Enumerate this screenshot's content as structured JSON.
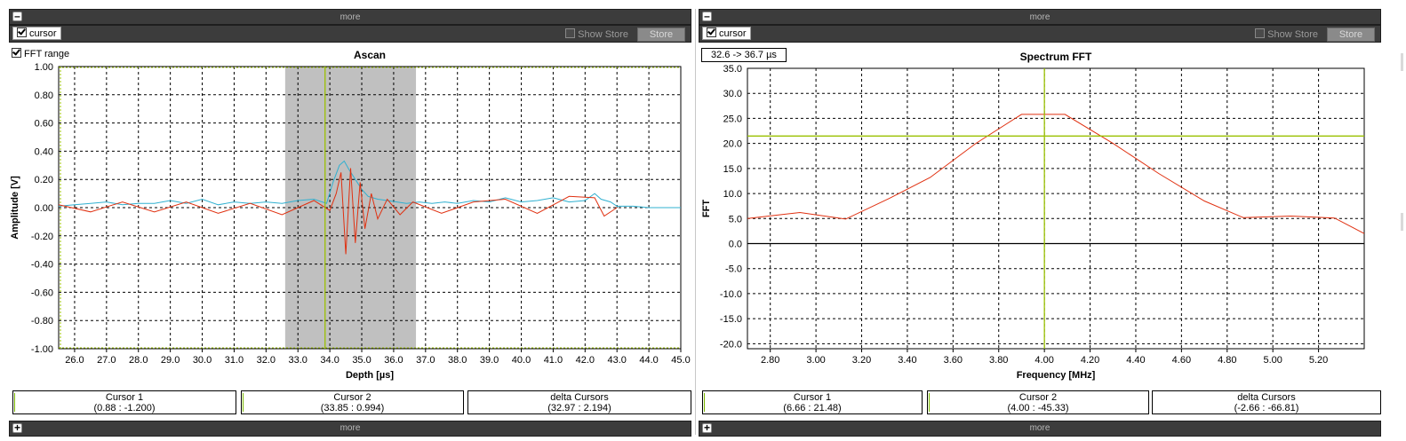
{
  "header": {
    "more_label": "more"
  },
  "toolbar": {
    "cursor_label": "cursor",
    "show_store_label": "Show Store",
    "store_button_label": "Store"
  },
  "ascan": {
    "fft_range_label": "FFT range",
    "cursor1": {
      "title": "Cursor 1",
      "value": "(0.88 : -1.200)"
    },
    "cursor2": {
      "title": "Cursor 2",
      "value": "(33.85 : 0.994)"
    },
    "delta": {
      "title": "delta Cursors",
      "value": "(32.97 : 2.194)"
    }
  },
  "fft": {
    "range_label": "32.6 -> 36.7 µs",
    "cursor1": {
      "title": "Cursor 1",
      "value": "(6.66 : 21.48)"
    },
    "cursor2": {
      "title": "Cursor 2",
      "value": "(4.00 : -45.33)"
    },
    "delta": {
      "title": "delta Cursors",
      "value": "(-2.66 : -66.81)"
    }
  },
  "colors": {
    "signal": "#e03010",
    "envelope": "#30b0d0",
    "cursor": "#9ac000",
    "window": "#c0c0c0",
    "panel_bar": "#3c3c3c"
  },
  "chart_data": [
    {
      "type": "line",
      "title": "Ascan",
      "xlabel": "Depth [µs]",
      "ylabel": "Amplitude [V]",
      "xlim": [
        25.5,
        45.0
      ],
      "ylim": [
        -1.0,
        1.0
      ],
      "x_ticks": [
        "26.0",
        "27.0",
        "28.0",
        "29.0",
        "30.0",
        "31.0",
        "32.0",
        "33.0",
        "34.0",
        "35.0",
        "36.0",
        "37.0",
        "38.0",
        "39.0",
        "40.0",
        "41.0",
        "42.0",
        "43.0",
        "44.0",
        "45.0"
      ],
      "y_ticks": [
        "1.00",
        "0.80",
        "0.60",
        "0.40",
        "0.20",
        "0.00",
        "-0.20",
        "-0.40",
        "-0.60",
        "-0.80",
        "-1.00"
      ],
      "grid": true,
      "fft_window": [
        32.6,
        36.7
      ],
      "vertical_cursor_x": 33.85,
      "series": [
        {
          "name": "",
          "x": [
            25.5,
            26.0,
            26.5,
            27.0,
            27.5,
            28.0,
            28.5,
            29.0,
            29.5,
            30.0,
            30.5,
            31.0,
            31.5,
            32.0,
            32.5,
            33.0,
            33.5,
            33.9,
            34.1,
            34.3,
            34.45,
            34.6,
            34.8,
            35.0,
            35.2,
            35.5,
            35.8,
            36.1,
            36.4,
            36.8,
            37.2,
            37.6,
            38.0,
            38.5,
            39.0,
            39.5,
            40.0,
            40.5,
            41.0,
            41.5,
            42.0,
            42.3,
            42.5,
            42.8,
            43.0,
            43.5,
            44.0,
            44.5,
            45.0
          ],
          "values": [
            0.01,
            0.02,
            0.03,
            0.04,
            0.02,
            0.03,
            0.03,
            0.05,
            0.03,
            0.06,
            0.02,
            0.04,
            0.03,
            0.04,
            0.03,
            0.05,
            0.06,
            0.03,
            0.18,
            0.3,
            0.33,
            0.27,
            0.2,
            0.13,
            0.08,
            0.06,
            0.05,
            0.04,
            0.03,
            0.04,
            0.03,
            0.04,
            0.03,
            0.05,
            0.04,
            0.07,
            0.04,
            0.05,
            0.07,
            0.04,
            0.05,
            0.1,
            0.06,
            0.04,
            0.01,
            0.01,
            0.0,
            0.0,
            0.0
          ]
        },
        {
          "name": "",
          "x": [
            25.5,
            26.5,
            27.5,
            28.5,
            29.5,
            30.5,
            31.5,
            32.5,
            33.5,
            34.0,
            34.2,
            34.35,
            34.5,
            34.65,
            34.8,
            34.95,
            35.1,
            35.3,
            35.5,
            35.8,
            36.2,
            36.6,
            37.5,
            38.5,
            39.5,
            40.5,
            41.5,
            42.3,
            42.6,
            43.0
          ],
          "values": [
            0.02,
            -0.03,
            0.04,
            -0.03,
            0.04,
            -0.04,
            0.03,
            -0.05,
            0.05,
            -0.02,
            0.1,
            0.25,
            -0.33,
            0.28,
            -0.25,
            0.18,
            -0.15,
            0.1,
            -0.08,
            0.06,
            -0.05,
            0.04,
            -0.04,
            0.04,
            0.06,
            -0.04,
            0.08,
            0.07,
            -0.06,
            0.0
          ]
        }
      ]
    },
    {
      "type": "line",
      "title": "Spectrum FFT",
      "xlabel": "Frequency [MHz]",
      "ylabel": "FFT",
      "xlim": [
        2.7,
        5.4
      ],
      "ylim": [
        -21.0,
        35.0
      ],
      "x_ticks": [
        "2.80",
        "3.00",
        "3.20",
        "3.40",
        "3.60",
        "3.80",
        "4.00",
        "4.20",
        "4.40",
        "4.60",
        "4.80",
        "5.00",
        "5.20"
      ],
      "y_ticks": [
        "35.0",
        "30.0",
        "25.0",
        "20.0",
        "15.0",
        "10.0",
        "5.0",
        "0.0",
        "-5.0",
        "-10.0",
        "-15.0",
        "-20.0"
      ],
      "grid": true,
      "vertical_cursor_x": 4.0,
      "horizontal_cursor_y": 21.48,
      "series": [
        {
          "name": "",
          "x": [
            2.7,
            2.93,
            3.13,
            3.32,
            3.5,
            3.7,
            3.9,
            4.09,
            4.3,
            4.5,
            4.7,
            4.87,
            5.08,
            5.27,
            5.4
          ],
          "values": [
            5.0,
            6.2,
            4.9,
            9.0,
            13.2,
            20.0,
            25.8,
            25.8,
            20.0,
            14.0,
            8.5,
            5.2,
            5.5,
            5.1,
            2.0
          ]
        }
      ]
    }
  ]
}
